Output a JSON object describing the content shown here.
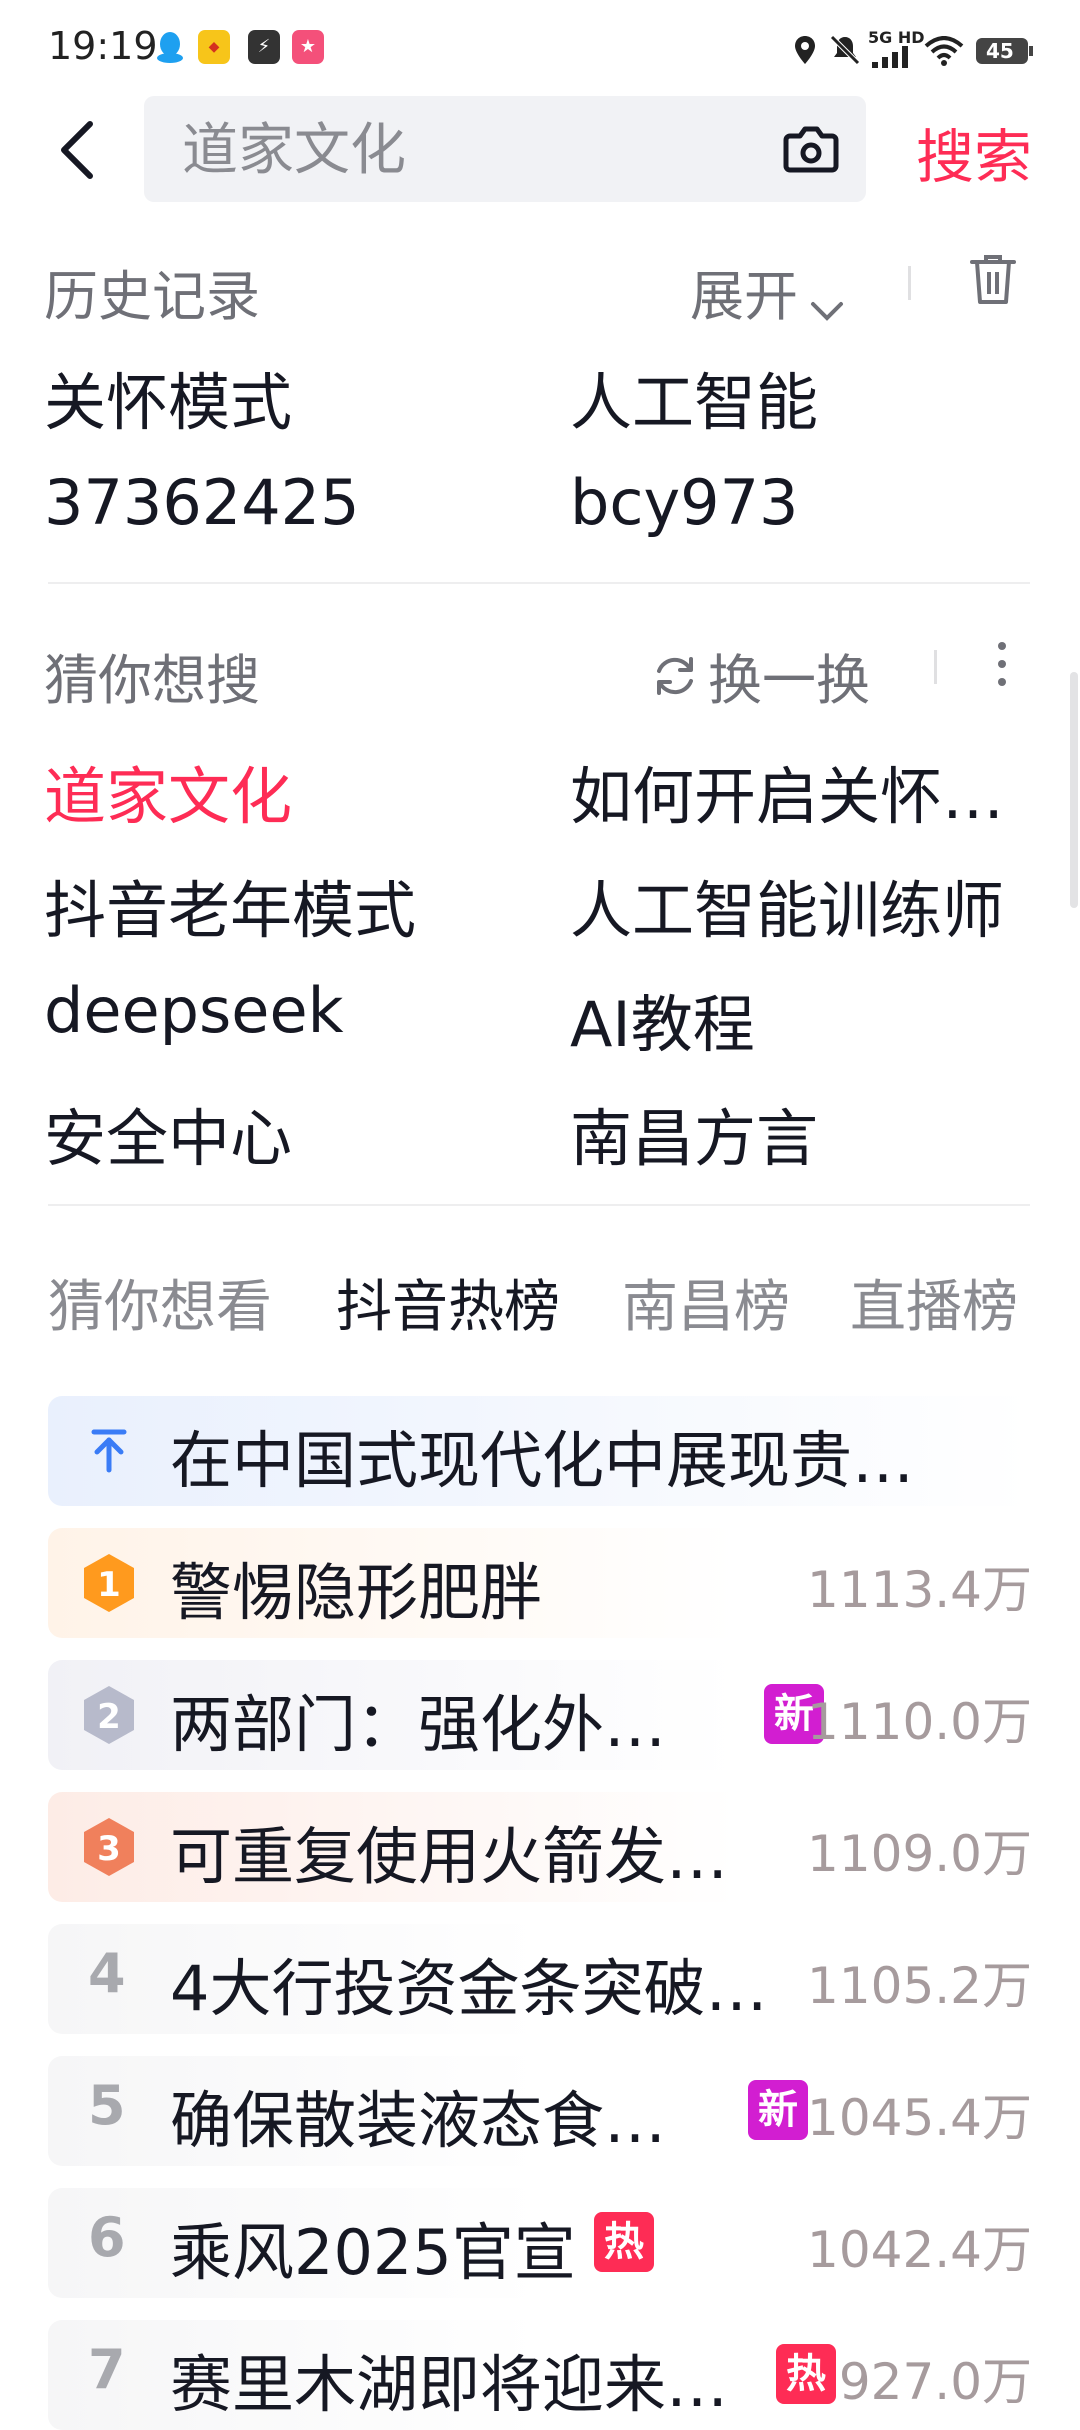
{
  "status_bar": {
    "time": "19:19",
    "network": "5G HD",
    "battery": "45",
    "icons": [
      "qq-icon",
      "app-badge-icon",
      "app-bolt-icon",
      "app-pink-icon",
      "location-icon",
      "mute-icon",
      "signal-icon",
      "wifi-icon",
      "battery-icon"
    ]
  },
  "search": {
    "value": "",
    "placeholder": "道家文化",
    "button_label": "搜索"
  },
  "history": {
    "title": "历史记录",
    "expand_label": "展开",
    "items": [
      "关怀模式",
      "人工智能",
      "37362425",
      "bcy973"
    ]
  },
  "suggest": {
    "title": "猜你想搜",
    "refresh_label": "换一换",
    "items": [
      "道家文化",
      "如何开启关怀…",
      "抖音老年模式",
      "人工智能训练师",
      "deepseek",
      "AI教程",
      "安全中心",
      "南昌方言"
    ]
  },
  "tabs": [
    "猜你想看",
    "抖音热榜",
    "南昌榜",
    "直播榜"
  ],
  "hot_list": [
    {
      "rank": "",
      "title": "在中国式现代化中展现贵…",
      "heat": "",
      "badge": ""
    },
    {
      "rank": "1",
      "title": "警惕隐形肥胖",
      "heat": "1113.4万",
      "badge": ""
    },
    {
      "rank": "2",
      "title": "两部门：强化外…",
      "heat": "1110.0万",
      "badge": "新"
    },
    {
      "rank": "3",
      "title": "可重复使用火箭发…",
      "heat": "1109.0万",
      "badge": ""
    },
    {
      "rank": "4",
      "title": "4大行投资金条突破…",
      "heat": "1105.2万",
      "badge": ""
    },
    {
      "rank": "5",
      "title": "确保散装液态食…",
      "heat": "1045.4万",
      "badge": "新"
    },
    {
      "rank": "6",
      "title": "乘风2025官宣",
      "heat": "1042.4万",
      "badge": "热"
    },
    {
      "rank": "7",
      "title": "赛里木湖即将迎来…",
      "heat": "927.0万",
      "badge": "热"
    }
  ],
  "colors": {
    "accent": "#fe2c55",
    "rank1": "#ff9a1e",
    "rank2": "#b7bacb",
    "rank3": "#f0805c",
    "new_badge": "#d21ed1",
    "hot_badge": "#fe2c55",
    "pinned_arrow": "#3a7cf6"
  }
}
